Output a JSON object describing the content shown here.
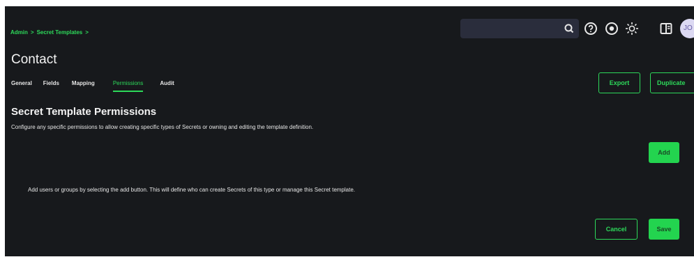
{
  "breadcrumb": {
    "items": [
      "Admin",
      "Secret Templates"
    ],
    "separator": ">"
  },
  "search": {
    "placeholder": ""
  },
  "user": {
    "initials": "JO"
  },
  "page": {
    "title": "Contact"
  },
  "tabs": [
    {
      "label": "General",
      "active": false
    },
    {
      "label": "Fields",
      "active": false
    },
    {
      "label": "Mapping",
      "active": false
    },
    {
      "label": "Permissions",
      "active": true
    },
    {
      "label": "Audit",
      "active": false
    }
  ],
  "header_actions": {
    "export_label": "Export",
    "duplicate_label": "Duplicate"
  },
  "permissions": {
    "title": "Secret Template Permissions",
    "description": "Configure any specific permissions to allow creating specific types of Secrets or owning and editing the template definition.",
    "add_label": "Add",
    "empty_message": "Add users or groups by selecting the add button. This will define who can create Secrets of this type or manage this Secret template."
  },
  "footer": {
    "cancel_label": "Cancel",
    "save_label": "Save"
  },
  "colors": {
    "accent": "#2dd95a",
    "background": "#17191c",
    "search_bg": "#2a2d3c"
  },
  "icons": [
    "search-icon",
    "help-icon",
    "record-icon",
    "theme-sun-icon",
    "panel-toggle-icon"
  ]
}
